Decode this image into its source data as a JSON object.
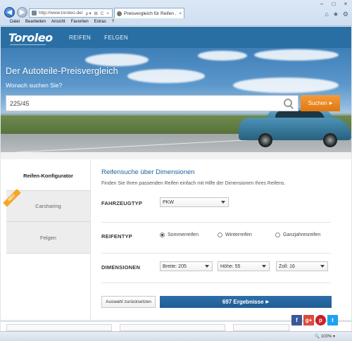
{
  "browser": {
    "url": "http://www.toroleo.de/",
    "tab_title": "Preisvergleich für Reifen ...",
    "menu": [
      "Datei",
      "Bearbeiten",
      "Ansicht",
      "Favoriten",
      "Extras",
      "?"
    ],
    "zoom": "100%"
  },
  "site": {
    "logo": "Toroleo",
    "nav": [
      "REIFEN",
      "FELGEN"
    ]
  },
  "hero": {
    "title": "Der Autoteile-Preisvergleich",
    "subtitle": "Wonach suchen Sie?",
    "search_value": "225/45",
    "search_button": "Suchen"
  },
  "sidebar": {
    "items": [
      {
        "label": "Reifen-Konfigurator",
        "active": true
      },
      {
        "label": "Carsharing",
        "badge": "NEU"
      },
      {
        "label": "Felgen"
      }
    ]
  },
  "search_form": {
    "heading": "Reifensuche über Dimensionen",
    "description": "Finden Sie Ihren passenden Reifen einfach mit Hilfe der Dimensionen Ihres Reifens.",
    "vehicle_label": "FAHRZEUGTYP",
    "vehicle_value": "PKW",
    "tiretype_label": "REIFENTYP",
    "tiretypes": [
      "Sommerreifen",
      "Winterreifen",
      "Ganzjahresreifen"
    ],
    "tiretype_selected": "Sommerreifen",
    "dimensions_label": "DIMENSIONEN",
    "width": "Breite: 205",
    "height": "Höhe: 55",
    "rim": "Zoll: 16",
    "reset_button": "Auswahl zurücksetzen",
    "results_button": "697 Ergebnisse"
  },
  "social": {
    "facebook": "f",
    "googleplus": "g+",
    "pinterest": "p",
    "twitter": "t"
  },
  "colors": {
    "brand_blue": "#2a6fa4",
    "accent_orange": "#e98a22",
    "heading_blue": "#1f5f96"
  }
}
